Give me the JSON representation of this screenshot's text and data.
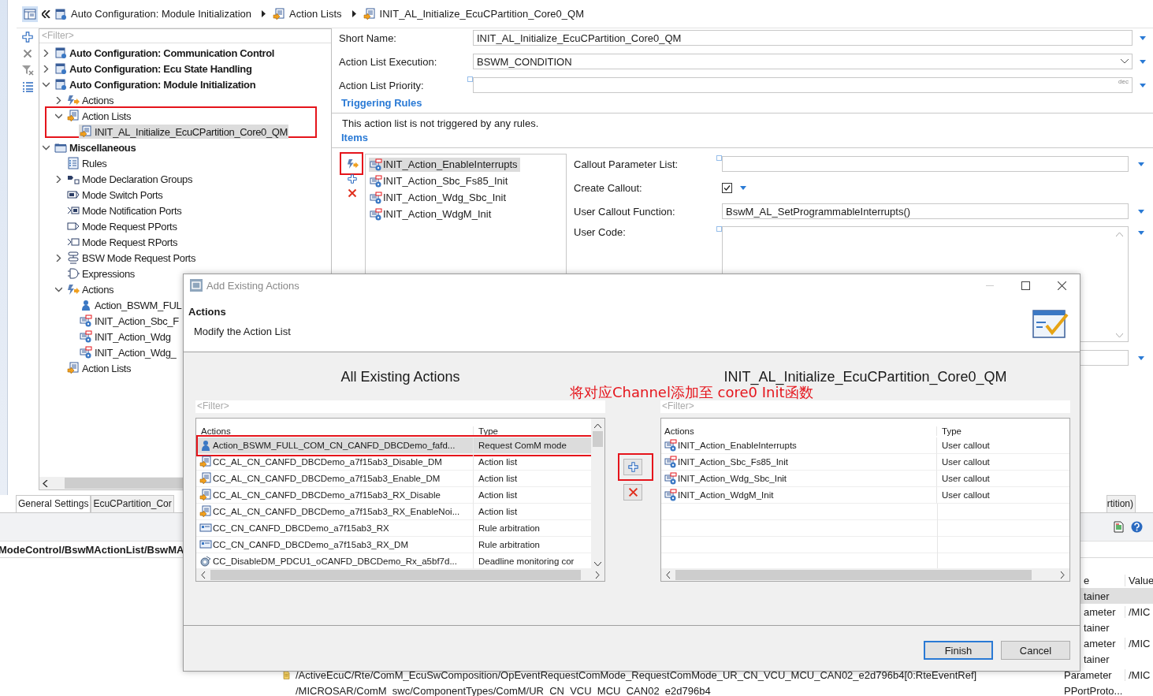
{
  "breadcrumb": [
    {
      "kind": "config",
      "label": "Auto Configuration: Module Initialization"
    },
    {
      "kind": "actionlist",
      "label": "Action Lists"
    },
    {
      "kind": "actionlist",
      "label": "INIT_AL_Initialize_EcuCPartition_Core0_QM"
    }
  ],
  "tree": {
    "filter_placeholder": "<Filter>",
    "items": [
      {
        "label": "Auto Configuration: Communication Control",
        "kind": "config",
        "expanded": false,
        "selected": false,
        "highlighted": false
      },
      {
        "label": "Auto Configuration: Ecu State Handling",
        "kind": "config",
        "expanded": false,
        "selected": false,
        "highlighted": false
      },
      {
        "label": "Auto Configuration: Module Initialization",
        "kind": "config",
        "expanded": true,
        "selected": false,
        "highlighted": false,
        "children": [
          {
            "label": "Actions",
            "kind": "action",
            "expanded": false,
            "selected": false,
            "highlighted": false
          },
          {
            "label": "Action Lists",
            "kind": "actionlist",
            "expanded": true,
            "selected": false,
            "highlighted": true,
            "children": [
              {
                "label": "INIT_AL_Initialize_EcuCPartition_Core0_QM",
                "kind": "actionlist",
                "selected": true,
                "highlighted": false
              }
            ]
          }
        ]
      },
      {
        "label": "Miscellaneous",
        "kind": "folder",
        "expanded": true,
        "selected": false,
        "highlighted": false,
        "children": [
          {
            "label": "Rules",
            "kind": "rules",
            "selected": false,
            "highlighted": false
          },
          {
            "label": "Mode Declaration Groups",
            "kind": "modegroup",
            "expanded": false,
            "selected": false,
            "highlighted": false
          },
          {
            "label": "Mode Switch Ports",
            "kind": "switchport",
            "selected": false,
            "highlighted": false
          },
          {
            "label": "Mode Notification Ports",
            "kind": "notifport",
            "selected": false,
            "highlighted": false
          },
          {
            "label": "Mode Request PPorts",
            "kind": "pport",
            "selected": false,
            "highlighted": false
          },
          {
            "label": "Mode Request RPorts",
            "kind": "rport",
            "selected": false,
            "highlighted": false
          },
          {
            "label": "BSW Mode Request Ports",
            "kind": "bswport",
            "expanded": false,
            "selected": false,
            "highlighted": false
          },
          {
            "label": "Expressions",
            "kind": "expression",
            "selected": false,
            "highlighted": false
          },
          {
            "label": "Actions",
            "kind": "action",
            "expanded": true,
            "selected": false,
            "highlighted": false,
            "children": [
              {
                "label": "Action_BSWM_FUL",
                "kind": "comm",
                "selected": false,
                "highlighted": false
              },
              {
                "label": "INIT_Action_Sbc_F",
                "kind": "callout",
                "selected": false,
                "highlighted": false
              },
              {
                "label": "INIT_Action_Wdg",
                "kind": "callout",
                "selected": false,
                "highlighted": false
              },
              {
                "label": "INIT_Action_Wdg_",
                "kind": "callout",
                "selected": false,
                "highlighted": false
              }
            ]
          },
          {
            "label": "Action Lists",
            "kind": "actionlist",
            "selected": false,
            "highlighted": false
          }
        ]
      }
    ]
  },
  "editor_tabs": [
    {
      "label": "General Settings",
      "selected": true
    },
    {
      "label": "EcuCPartition_Cor",
      "selected": false
    },
    {
      "label": "rtition)",
      "selected": false
    }
  ],
  "form": {
    "fields": [
      {
        "label": "Short Name:",
        "kind": "text",
        "value": "INIT_AL_Initialize_EcuCPartition_Core0_QM",
        "marked": false
      },
      {
        "label": "Action List Execution:",
        "kind": "dropdown",
        "value": "BSWM_CONDITION",
        "marked": false
      },
      {
        "label": "Action List Priority:",
        "kind": "number",
        "unit": "dec",
        "marked": true
      }
    ]
  },
  "triggering_rules": {
    "title": "Triggering Rules",
    "message": "This action list is not triggered by any rules."
  },
  "items": {
    "title": "Items",
    "tools": [
      {
        "kind": "action",
        "highlighted": true
      },
      {
        "kind": "add",
        "highlighted": false
      },
      {
        "kind": "remove",
        "highlighted": false
      }
    ],
    "list": [
      {
        "label": "INIT_Action_EnableInterrupts",
        "selected": true
      },
      {
        "label": "INIT_Action_Sbc_Fs85_Init",
        "selected": false
      },
      {
        "label": "INIT_Action_Wdg_Sbc_Init",
        "selected": false
      },
      {
        "label": "INIT_Action_WdgM_Init",
        "selected": false
      }
    ],
    "details": [
      {
        "label": "Callout Parameter List:",
        "kind": "text",
        "marked": true
      },
      {
        "label": "Create Callout:",
        "kind": "checkbox",
        "checked": true,
        "marked": false
      },
      {
        "label": "User Callout Function:",
        "kind": "text",
        "value": "BswM_AL_SetProgrammableInterrupts()",
        "marked": false
      },
      {
        "label": "User Code:",
        "kind": "textarea",
        "marked": true
      },
      {
        "kind": "text",
        "marked": false
      }
    ]
  },
  "path_bar": "ModeControl/BswMActionList/BswMA",
  "properties_table": {
    "columns": [
      "e",
      "Value"
    ],
    "rows": [
      {
        "type": "tainer",
        "selected": true
      },
      {
        "type": "ameter",
        "value": "/MIC",
        "selected": false
      },
      {
        "type": "tainer",
        "selected": false
      },
      {
        "type": "ameter",
        "value": "/MIC",
        "selected": false
      },
      {
        "type": "tainer",
        "selected": false
      },
      {
        "kind": "reference",
        "name": "/ActiveEcuC/Rte/ComM_EcuSwComposition/OpEventRequestComMode_RequestComMode_UR_CN_VCU_MCU_CAN02_e2d796b4[0:RteEventRef]",
        "type": "Parameter",
        "value": "/MIC",
        "selected": false
      },
      {
        "name": "/MICROSAR/ComM_swc/ComponentTypes/ComM/UR_CN_VCU_MCU_CAN02_e2d796b4",
        "type": "PPortProto...",
        "selected": false
      }
    ]
  },
  "dialog": {
    "title": "Add Existing Actions",
    "header_title": "Actions",
    "header_subtitle": "Modify the Action List",
    "left": {
      "title": "All Existing Actions",
      "filter_placeholder": "<Filter>",
      "columns": [
        "Actions",
        "Type"
      ],
      "rows": [
        {
          "kind": "comm",
          "name": "Action_BSWM_FULL_COM_CN_CANFD_DBCDemo_fafd...",
          "type": "Request ComM mode",
          "selected": true,
          "highlighted": true
        },
        {
          "kind": "actionlist",
          "name": "CC_AL_CN_CANFD_DBCDemo_a7f15ab3_Disable_DM",
          "type": "Action list",
          "selected": false,
          "highlighted": false
        },
        {
          "kind": "actionlist",
          "name": "CC_AL_CN_CANFD_DBCDemo_a7f15ab3_Enable_DM",
          "type": "Action list",
          "selected": false,
          "highlighted": false
        },
        {
          "kind": "actionlist",
          "name": "CC_AL_CN_CANFD_DBCDemo_a7f15ab3_RX_Disable",
          "type": "Action list",
          "selected": false,
          "highlighted": false
        },
        {
          "kind": "actionlist",
          "name": "CC_AL_CN_CANFD_DBCDemo_a7f15ab3_RX_EnableNoi...",
          "type": "Action list",
          "selected": false,
          "highlighted": false
        },
        {
          "kind": "rule",
          "name": "CC_CN_CANFD_DBCDemo_a7f15ab3_RX",
          "type": "Rule arbitration",
          "selected": false,
          "highlighted": false
        },
        {
          "kind": "rule",
          "name": "CC_CN_CANFD_DBCDemo_a7f15ab3_RX_DM",
          "type": "Rule arbitration",
          "selected": false,
          "highlighted": false
        },
        {
          "kind": "deadline",
          "name": "CC_DisableDM_PDCU1_oCANFD_DBCDemo_Rx_a5bf7d...",
          "type": "Deadline monitoring cor",
          "selected": false,
          "highlighted": false
        }
      ]
    },
    "right": {
      "title": "INIT_AL_Initialize_EcuCPartition_Core0_QM",
      "filter_placeholder": "<Filter>",
      "columns": [
        "Actions",
        "Type"
      ],
      "rows": [
        {
          "kind": "callout",
          "name": "INIT_Action_EnableInterrupts",
          "type": "User callout"
        },
        {
          "kind": "callout",
          "name": "INIT_Action_Sbc_Fs85_Init",
          "type": "User callout"
        },
        {
          "kind": "callout",
          "name": "INIT_Action_Wdg_Sbc_Init",
          "type": "User callout"
        },
        {
          "kind": "callout",
          "name": "INIT_Action_WdgM_Init",
          "type": "User callout"
        }
      ]
    },
    "move_buttons": [
      {
        "kind": "add",
        "highlighted": true
      },
      {
        "kind": "remove",
        "highlighted": false
      }
    ],
    "buttons": [
      {
        "label": "Finish",
        "default": true
      },
      {
        "label": "Cancel",
        "default": false
      }
    ],
    "annotation": "将对应Channel添加至 core0 Init函数"
  }
}
